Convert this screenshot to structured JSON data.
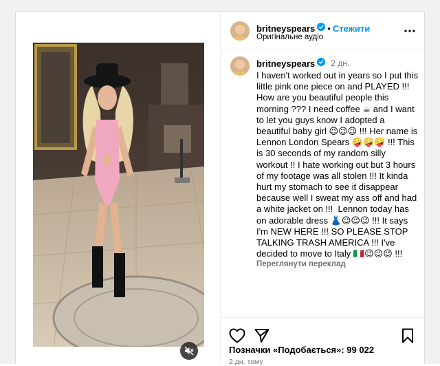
{
  "post": {
    "username": "britneyspears",
    "follow_label": "Стежити",
    "audio": "Оригінальне аудіо",
    "time_ago": "2 дн.",
    "caption": "I haven't worked out in years so I put this little pink one piece on and PLAYED !!! How are you beautiful people this morning ??? I need coffee ☕ and I want to let you guys know I adopted a beautiful baby girl 😉😉😉 !!! Her name is Lennon London Spears 🤪🤪🤪 !!! This is 30 seconds of my random silly workout !! I hate working out but 3 hours of my footage was all stolen !!! It kinda hurt my stomach to see it disappear because well I sweat my ass off and had a white jacket on !!!  Lennon today has on adorable dress 👗😉😉😉 !!! It says I'm NEW HERE !!! SO PLEASE STOP TALKING TRASH AMERICA !!! I've decided to move to Italy 🇮🇹😉😉😉 !!!",
    "translate_label": "Переглянути переклад",
    "likes": "Позначки «Подобається»: 99 022",
    "date": "2 дн. тому"
  },
  "icons": {
    "verified": "verified-badge-icon",
    "more": "more-options-icon",
    "like": "heart-icon",
    "share": "paper-plane-icon",
    "save": "bookmark-icon",
    "mute": "speaker-muted-icon"
  },
  "colors": {
    "accent": "#0095f6",
    "secondary_text": "#737373",
    "verified": "#0095f6"
  }
}
